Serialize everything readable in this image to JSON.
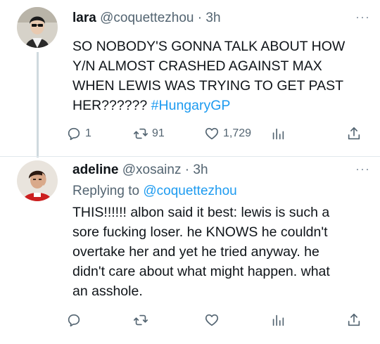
{
  "tweets": [
    {
      "name": "lara",
      "handle": "@coquettezhou",
      "separator": "·",
      "time": "3h",
      "more": "···",
      "text_lines": [
        "SO NOBODY'S GONNA TALK ABOUT HOW",
        "Y/N ALMOST CRASHED AGAINST MAX",
        "WHEN LEWIS WAS TRYING TO GET PAST"
      ],
      "text_last": "HER?????? ",
      "hashtag": "#HungaryGP",
      "replies": "1",
      "retweets": "91",
      "likes": "1,729"
    },
    {
      "name": "adeline",
      "handle": "@xosainz",
      "separator": "·",
      "time": "3h",
      "more": "···",
      "replying_prefix": "Replying to ",
      "replying_handle": "@coquettezhou",
      "text_lines": [
        "THIS!!!!!! albon said it best: lewis is such a",
        "sore fucking loser. he KNOWS he couldn't",
        "overtake her and yet he tried anyway. he",
        "didn't care about what might happen. what",
        "an asshole."
      ]
    }
  ],
  "icons": [
    "reply-icon",
    "retweet-icon",
    "like-icon",
    "views-icon",
    "share-icon",
    "more-icon"
  ],
  "colors": {
    "link": "#1d9bf0",
    "secondary": "#536471",
    "divider": "#e1e8ed"
  }
}
